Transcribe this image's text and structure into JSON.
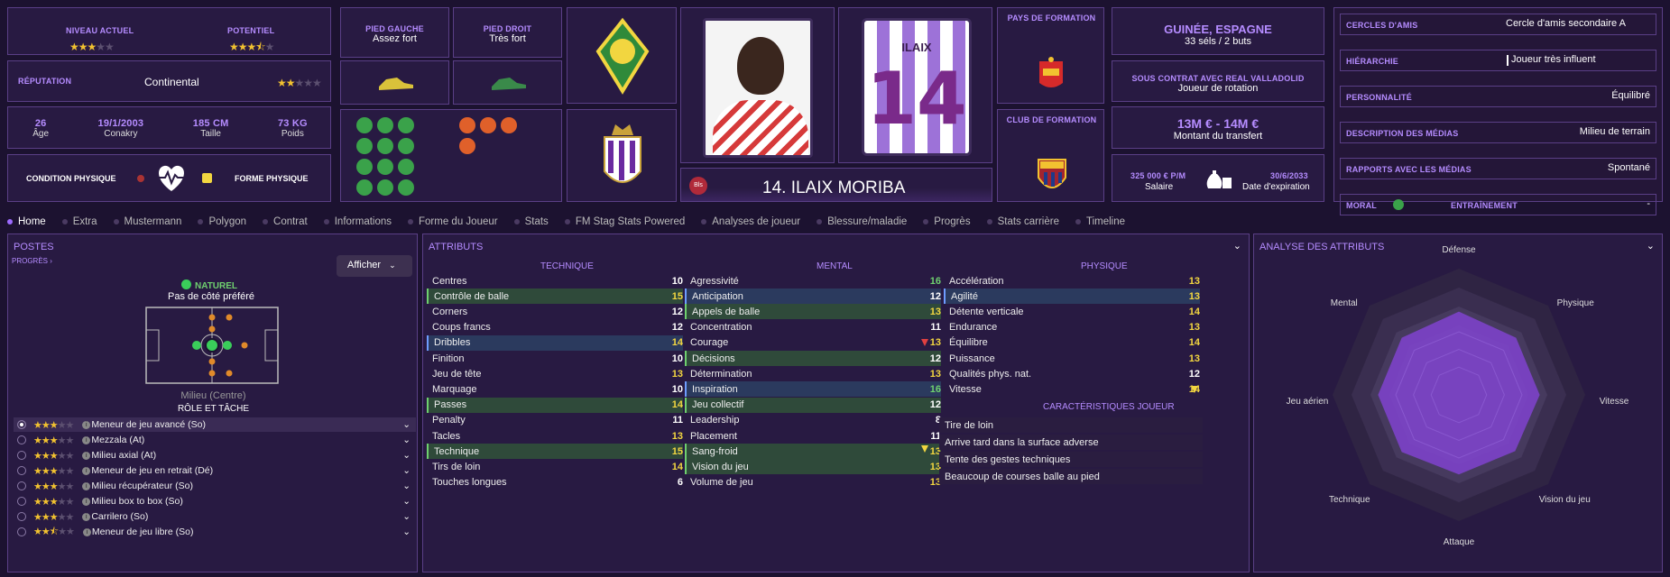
{
  "colors": {
    "accent": "#b58cff",
    "green": "#6fd06f",
    "yellow": "#f2d640",
    "panel": "#281a42"
  },
  "ability": {
    "current_label": "NIVEAU ACTUEL",
    "current_stars": 3,
    "potential_label": "POTENTIEL",
    "potential_stars": 3.5
  },
  "reputation": {
    "label": "RÉPUTATION",
    "value": "Continental",
    "stars": 2
  },
  "bio": [
    {
      "value": "26",
      "label": "Âge"
    },
    {
      "value": "19/1/2003",
      "label": "Conakry"
    },
    {
      "value": "185 CM",
      "label": "Taille"
    },
    {
      "value": "73 KG",
      "label": "Poids"
    }
  ],
  "condition": {
    "label": "CONDITION PHYSIQUE",
    "form_label": "FORME PHYSIQUE"
  },
  "feet": {
    "left_label": "PIED GAUCHE",
    "left_value": "Assez fort",
    "right_label": "PIED DROIT",
    "right_value": "Très fort"
  },
  "training_label": "PAYS DE FORMATION",
  "club_training_label": "CLUB DE FORMATION",
  "nationality": {
    "value": "GUINÉE, ESPAGNE",
    "caps": "33 séls / 2 buts"
  },
  "contract": {
    "label": "SOUS CONTRAT AVEC REAL VALLADOLID",
    "role": "Joueur de rotation"
  },
  "transfer": {
    "value": "13M € - 14M €",
    "label": "Montant du transfert"
  },
  "wage": {
    "value": "325 000 € P/M",
    "label": "Salaire",
    "expiry": "30/6/2033",
    "expiry_label": "Date d'expiration"
  },
  "player": {
    "name": "14. ILAIX MORIBA",
    "badge": "Bls",
    "shirt_name": "ILAIX",
    "shirt_number": "14"
  },
  "personal": [
    {
      "label": "CERCLES D'AMIS",
      "value": "Cercle d'amis secondaire A"
    },
    {
      "label": "HIÉRARCHIE",
      "value": "Joueur très influent"
    },
    {
      "label": "PERSONNALITÉ",
      "value": "Équilibré"
    },
    {
      "label": "DESCRIPTION DES MÉDIAS",
      "value": "Milieu de terrain"
    },
    {
      "label": "RAPPORTS AVEC LES MÉDIAS",
      "value": "Spontané"
    }
  ],
  "morale": {
    "label": "MORAL",
    "training_label": "ENTRAÎNEMENT",
    "training_value": "-"
  },
  "tabs": [
    "Home",
    "Extra",
    "Mustermann",
    "Polygon",
    "Contrat",
    "Informations",
    "Forme du Joueur",
    "Stats",
    "FM Stag Stats Powered",
    "Analyses de joueur",
    "Blessure/maladie",
    "Progrès",
    "Stats carrière",
    "Timeline"
  ],
  "positions": {
    "title": "POSTES",
    "progress": "PROGRÈS",
    "show_btn": "Afficher",
    "natural": "NATUREL",
    "side": "Pas de côté préféré",
    "position": "Milieu (Centre)",
    "role_title": "RÔLE ET TÂCHE"
  },
  "roles": [
    {
      "name": "Meneur de jeu avancé (So)",
      "stars": 3
    },
    {
      "name": "Mezzala (At)",
      "stars": 3
    },
    {
      "name": "Milieu axial (At)",
      "stars": 3
    },
    {
      "name": "Meneur de jeu en retrait (Dé)",
      "stars": 3
    },
    {
      "name": "Milieu récupérateur (So)",
      "stars": 3
    },
    {
      "name": "Milieu box to box (So)",
      "stars": 3
    },
    {
      "name": "Carrilero (So)",
      "stars": 3
    },
    {
      "name": "Meneur de jeu libre (So)",
      "stars": 2.5
    }
  ],
  "attributes": {
    "title": "ATTRIBUTS",
    "technique_title": "TECHNIQUE",
    "mental_title": "MENTAL",
    "physique_title": "PHYSIQUE",
    "technique": [
      [
        "Centres",
        "10",
        ""
      ],
      [
        "Contrôle de balle",
        "15",
        "g"
      ],
      [
        "Corners",
        "12",
        ""
      ],
      [
        "Coups francs",
        "12",
        ""
      ],
      [
        "Dribbles",
        "14",
        "b"
      ],
      [
        "Finition",
        "10",
        ""
      ],
      [
        "Jeu de tête",
        "13",
        ""
      ],
      [
        "Marquage",
        "10",
        ""
      ],
      [
        "Passes",
        "14",
        "g"
      ],
      [
        "Penalty",
        "11",
        ""
      ],
      [
        "Tacles",
        "13",
        ""
      ],
      [
        "Technique",
        "15",
        "g"
      ],
      [
        "Tirs de loin",
        "14",
        ""
      ],
      [
        "Touches longues",
        "6",
        ""
      ]
    ],
    "mental": [
      [
        "Agressivité",
        "16",
        ""
      ],
      [
        "Anticipation",
        "12",
        "b"
      ],
      [
        "Appels de balle",
        "13",
        "g"
      ],
      [
        "Concentration",
        "11",
        ""
      ],
      [
        "Courage",
        "13",
        ""
      ],
      [
        "Décisions",
        "12",
        "g"
      ],
      [
        "Détermination",
        "13",
        ""
      ],
      [
        "Inspiration",
        "16",
        "b"
      ],
      [
        "Jeu collectif",
        "12",
        "g"
      ],
      [
        "Leadership",
        "8",
        ""
      ],
      [
        "Placement",
        "11",
        ""
      ],
      [
        "Sang-froid",
        "13",
        "g"
      ],
      [
        "Vision du jeu",
        "13",
        "g"
      ],
      [
        "Volume de jeu",
        "13",
        ""
      ]
    ],
    "physique": [
      [
        "Accélération",
        "13",
        ""
      ],
      [
        "Agilité",
        "13",
        "b"
      ],
      [
        "Détente verticale",
        "14",
        ""
      ],
      [
        "Endurance",
        "13",
        ""
      ],
      [
        "Équilibre",
        "14",
        ""
      ],
      [
        "Puissance",
        "13",
        ""
      ],
      [
        "Qualités phys. nat.",
        "12",
        ""
      ],
      [
        "Vitesse",
        "14",
        ""
      ]
    ],
    "traits_title": "CARACTÉRISTIQUES JOUEUR",
    "traits": [
      "Tire de loin",
      "Arrive tard dans la surface adverse",
      "Tente des gestes techniques",
      "Beaucoup de courses balle au pied"
    ]
  },
  "analysis": {
    "title": "ANALYSE DES ATTRIBUTS",
    "labels": [
      "Défense",
      "Physique",
      "Vitesse",
      "Vision du jeu",
      "Attaque",
      "Technique",
      "Jeu aérien",
      "Mental"
    ],
    "levels": [
      0.66,
      0.64,
      0.64,
      0.63,
      0.63,
      0.64,
      0.64,
      0.64
    ]
  }
}
